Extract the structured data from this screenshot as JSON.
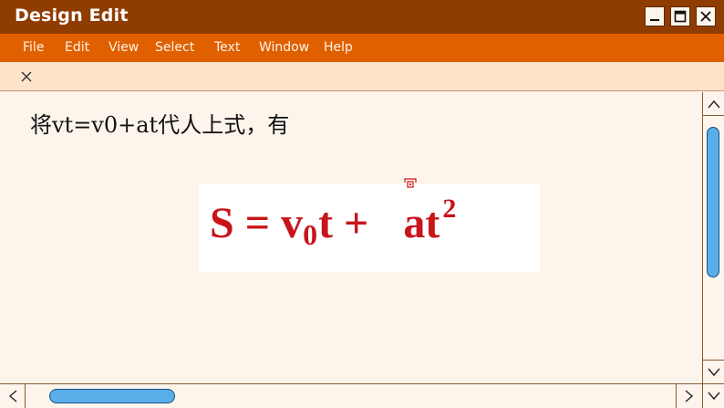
{
  "window": {
    "title": "Design Edit",
    "colors": {
      "titlebar": "#8f3c00",
      "menubar": "#e06000",
      "toolbar": "#fde4ca",
      "content_bg": "#fdf5ec",
      "formula_text": "#c8141a",
      "scroll_thumb": "#5aaee8"
    },
    "controls": {
      "minimize_icon": "minimize-icon",
      "maximize_icon": "maximize-icon",
      "close_icon": "close-icon"
    }
  },
  "menu": {
    "items": [
      {
        "label": "File"
      },
      {
        "label": "Edit"
      },
      {
        "label": "View"
      },
      {
        "label": "Select"
      },
      {
        "label": "Text"
      },
      {
        "label": "Window"
      },
      {
        "label": "Help"
      }
    ]
  },
  "toolbar": {
    "close_icon": "close-icon"
  },
  "content": {
    "caption": "将vt=v0+at代人上式，有",
    "formula": {
      "lhs": "S",
      "equals": "=",
      "v": "v",
      "v_subscript": "0",
      "t": "t",
      "plus": "+",
      "at": "at",
      "exponent": "2"
    }
  },
  "scrollbars": {
    "vertical": {
      "up_icon": "chevron-up-icon",
      "down_icon": "chevron-down-icon"
    },
    "horizontal": {
      "left_icon": "chevron-left-icon",
      "right_icon": "chevron-right-icon"
    }
  }
}
